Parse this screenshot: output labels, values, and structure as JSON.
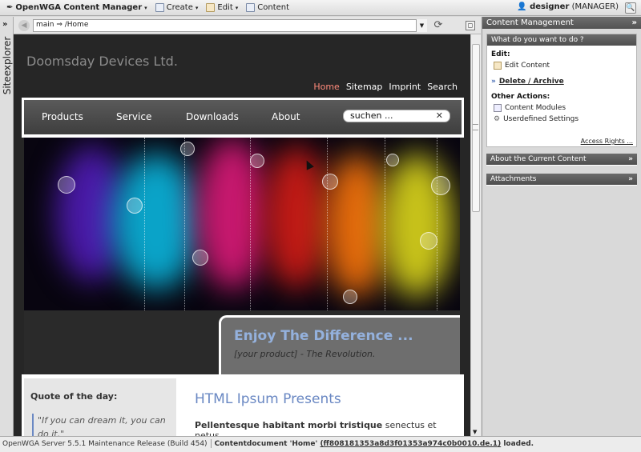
{
  "app": {
    "menu_label": "OpenWGA Content Manager",
    "toolbar": [
      {
        "label": "Create"
      },
      {
        "label": "Edit"
      },
      {
        "label": "Content"
      }
    ],
    "user_name": "designer",
    "user_role": "(MANAGER)"
  },
  "siteexplorer": {
    "label": "Siteexplorer"
  },
  "address": {
    "value": "main ⇒ /Home"
  },
  "site": {
    "title": "Doomsday Devices Ltd.",
    "topnav": [
      "Home",
      "Sitemap",
      "Imprint",
      "Search"
    ],
    "mainnav": [
      "Products",
      "Service",
      "Downloads",
      "About"
    ],
    "search_value": "suchen ...",
    "tagline_title": "Enjoy The Difference ...",
    "tagline_sub": "[your product] - The Revolution.",
    "quote_heading": "Quote of the day:",
    "quote_text": "\"If you can dream it, you can do it.\"",
    "article_heading": "HTML Ipsum Presents",
    "article_bold": "Pellentesque habitant morbi tristique",
    "article_rest": " senectus et netus"
  },
  "panel": {
    "title": "Content Management",
    "wywtd_title": "What do you want to do ?",
    "edit_label": "Edit:",
    "edit_content": "Edit Content",
    "delete_archive": "Delete / Archive",
    "other_actions": "Other Actions:",
    "content_modules": "Content Modules",
    "userdefined": "Userdefined Settings",
    "access_rights": "Access Rights ...",
    "about_current": "About the Current Content",
    "attachments": "Attachments"
  },
  "status": {
    "server": "OpenWGA Server 5.5.1 Maintenance Release (Build 454)",
    "msg_prefix": "Contentdocument 'Home' ",
    "msg_key": "(ff808181353a8d3f01353a974c0b0010.de.1)",
    "msg_suffix": " loaded."
  }
}
